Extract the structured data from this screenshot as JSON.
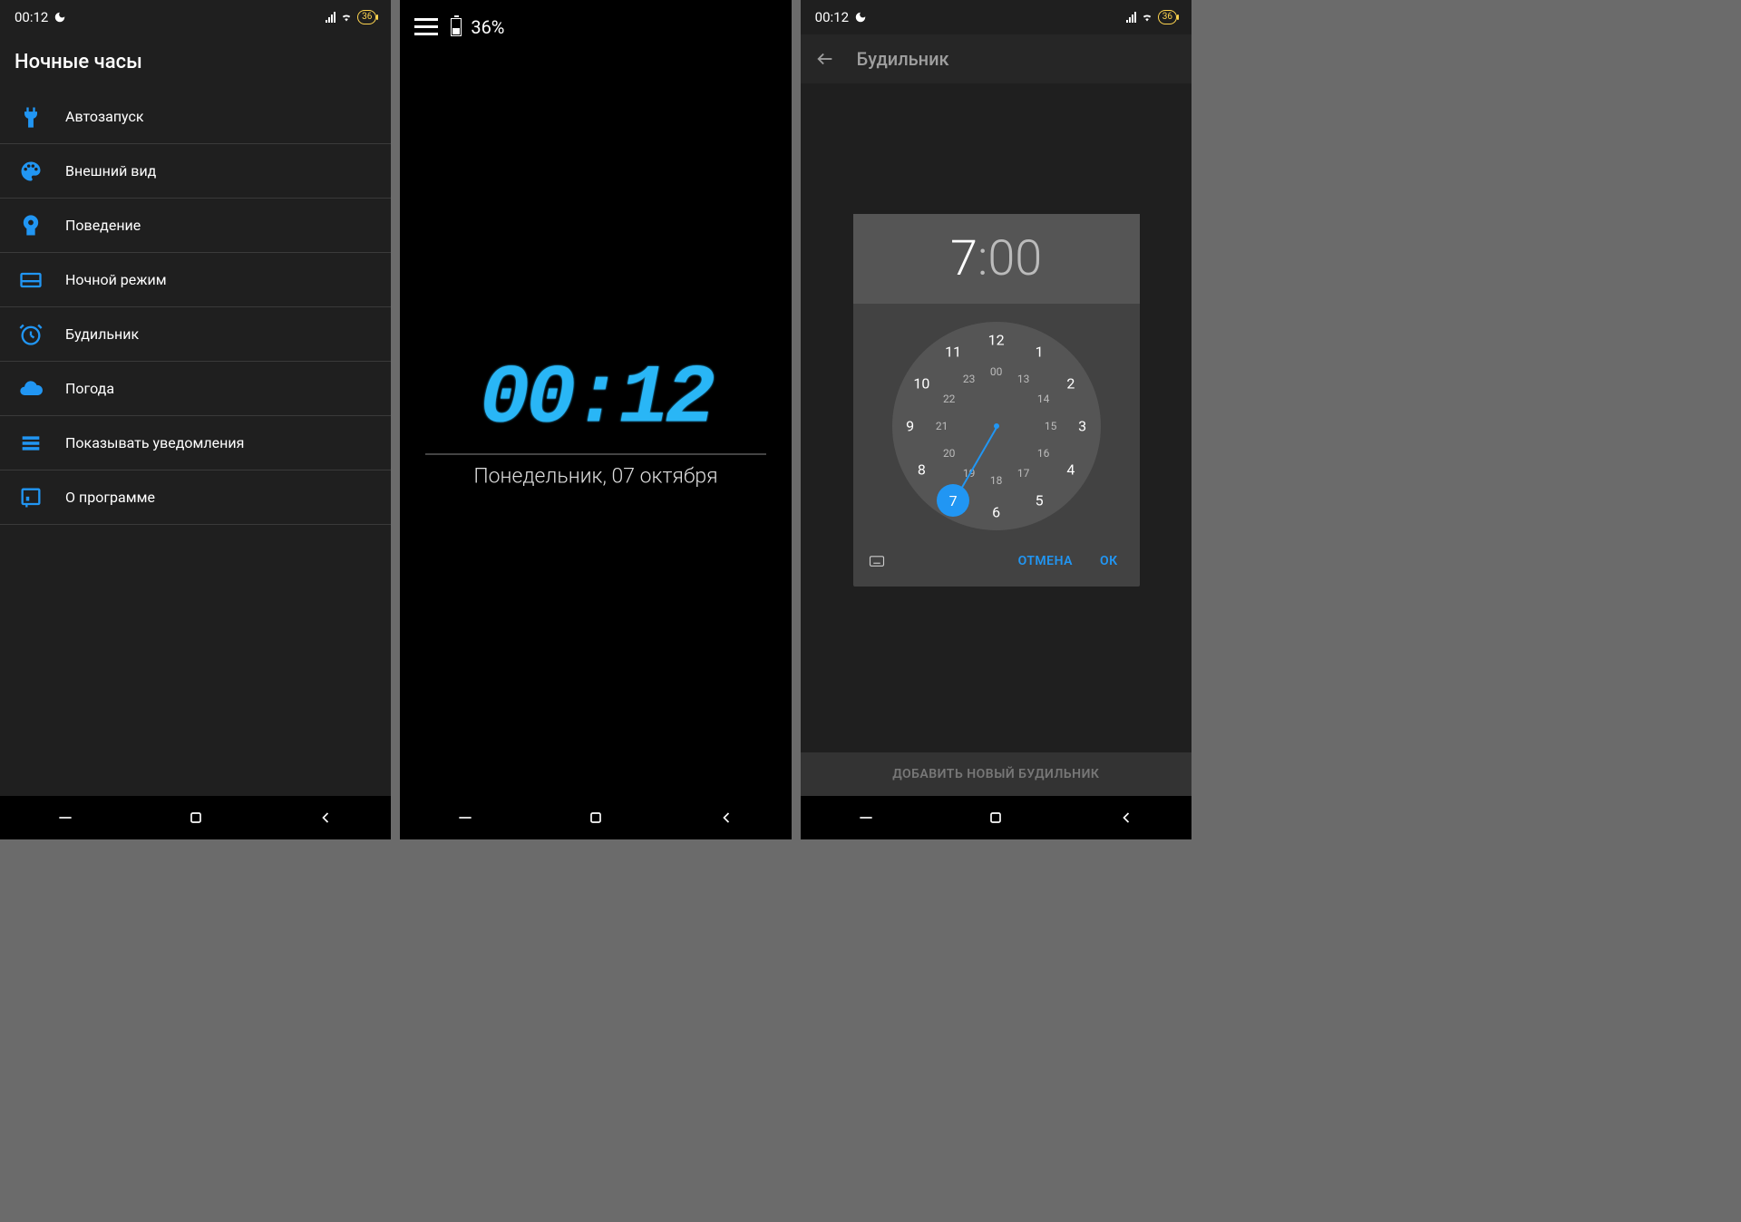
{
  "statusbar": {
    "time": "00:12",
    "battery_label": "36"
  },
  "screen1": {
    "title": "Ночные часы",
    "items": [
      {
        "icon": "plug-icon",
        "label": "Автозапуск"
      },
      {
        "icon": "palette-icon",
        "label": "Внешний вид"
      },
      {
        "icon": "gear-head-icon",
        "label": "Поведение"
      },
      {
        "icon": "bed-icon",
        "label": "Ночной режим"
      },
      {
        "icon": "alarm-icon",
        "label": "Будильник"
      },
      {
        "icon": "cloud-icon",
        "label": "Погода"
      },
      {
        "icon": "list-icon",
        "label": "Показывать уведомления"
      },
      {
        "icon": "info-icon",
        "label": "О программе"
      }
    ]
  },
  "screen2": {
    "battery": "36%",
    "time": "00:12",
    "date": "Понедельник, 07 октября"
  },
  "screen3": {
    "header": "Будильник",
    "time_hour": "7",
    "time_sep": ":",
    "time_min": "00",
    "selected_hour": 7,
    "outer_hours": [
      12,
      1,
      2,
      3,
      4,
      5,
      6,
      7,
      8,
      9,
      10,
      11
    ],
    "inner_hours": [
      "00",
      13,
      14,
      15,
      16,
      17,
      18,
      19,
      20,
      21,
      22,
      23
    ],
    "cancel": "ОТМЕНА",
    "ok": "ОК",
    "footer": "ДОБАВИТЬ НОВЫЙ БУДИЛЬНИК"
  }
}
